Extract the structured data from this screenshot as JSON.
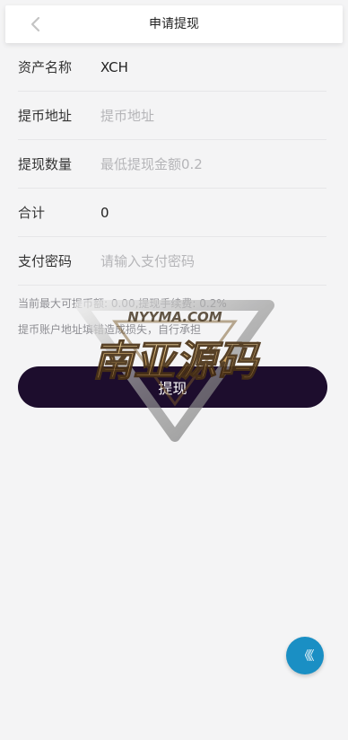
{
  "header": {
    "title": "申请提现"
  },
  "form": {
    "asset_name": {
      "label": "资产名称",
      "value": "XCH"
    },
    "address": {
      "label": "提币地址",
      "placeholder": "提币地址",
      "value": ""
    },
    "amount": {
      "label": "提现数量",
      "placeholder": "最低提现金额0.2",
      "value": ""
    },
    "total": {
      "label": "合计",
      "value": "0"
    },
    "password": {
      "label": "支付密码",
      "placeholder": "请输入支付密码",
      "value": ""
    }
  },
  "notes": {
    "max_and_fee": "当前最大可提币额: 0.00,提现手续费: 0.2%",
    "warning": "提币账户地址填错造成损失，自行承担"
  },
  "submit": {
    "label": "提现"
  },
  "watermark": {
    "text": "南亚源码",
    "domain": "NYYMA.COM"
  },
  "fab": {
    "glyph": "《《"
  },
  "colors": {
    "header_bg": "#ffffff",
    "page_bg": "#f4f4f5",
    "button_bg": "#1d0d2d",
    "fab_bg": "#1a8fc4"
  }
}
